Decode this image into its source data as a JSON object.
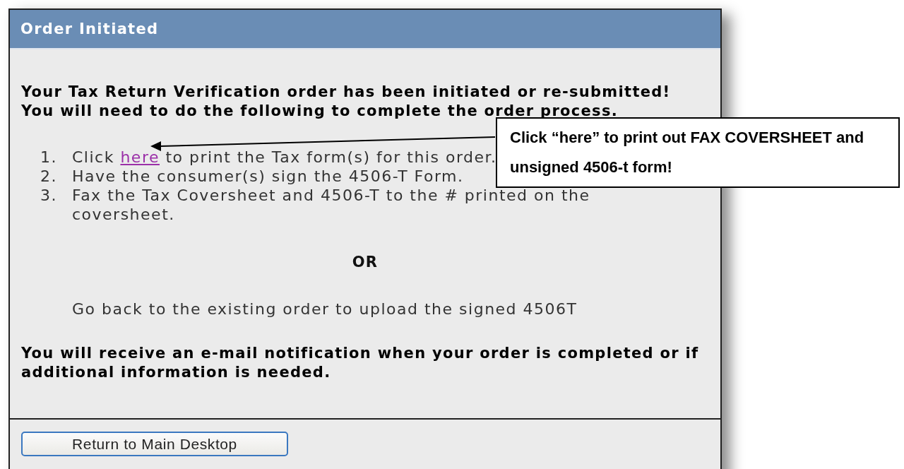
{
  "window": {
    "title": "Order Initiated"
  },
  "intro": [
    "Your Tax Return Verification order has been initiated or re-submitted!",
    "You will need to do the following to complete the order process."
  ],
  "steps": [
    {
      "number": "1.",
      "parts": [
        {
          "kind": "text",
          "text": "Click "
        },
        {
          "kind": "link",
          "text": "here"
        },
        {
          "kind": "text",
          "text": " to print the Tax form(s) for this order."
        }
      ]
    },
    {
      "number": "2.",
      "parts": [
        {
          "kind": "text",
          "text": "Have the consumer(s) sign the 4506-T Form."
        }
      ]
    },
    {
      "number": "3.",
      "parts": [
        {
          "kind": "text",
          "text": "Fax the Tax Coversheet and 4506-T to the # printed on the coversheet."
        }
      ]
    }
  ],
  "divider_text": "OR",
  "alternative": "Go back to the existing order to upload the signed 4506T",
  "notice": "You will receive an e-mail notification when your order is completed or if additional information is needed.",
  "button": "Return to Main Desktop",
  "callout": {
    "text": "Click “here” to print out FAX COVERSHEET and unsigned 4506-t form!"
  }
}
